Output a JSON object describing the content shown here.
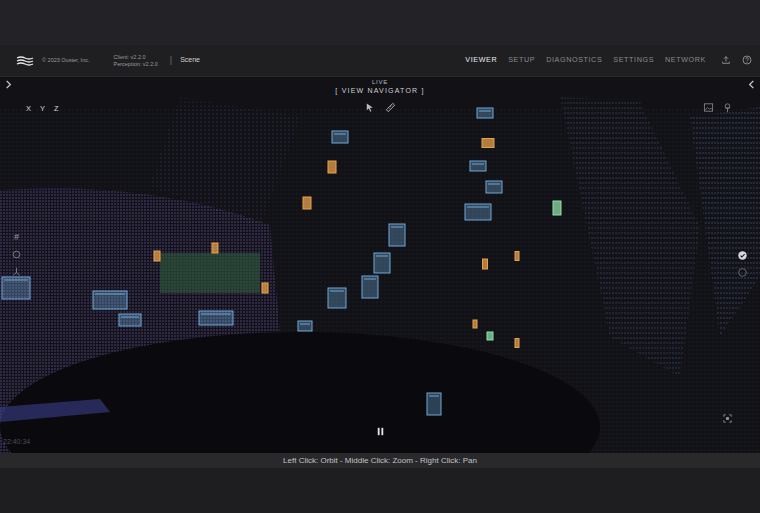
{
  "app": {
    "copyright": "© 2023 Ouster, Inc.",
    "client": "Client: v2.2.0",
    "perception": "Perception: v2.2.0",
    "separator": "|",
    "scene": "Scene"
  },
  "nav": [
    {
      "label": "VIEWER",
      "selected": true
    },
    {
      "label": "SETUP",
      "selected": false
    },
    {
      "label": "DIAGNOSTICS",
      "selected": false
    },
    {
      "label": "SETTINGS",
      "selected": false
    },
    {
      "label": "NETWORK",
      "selected": false
    }
  ],
  "viewer": {
    "live": "LIVE",
    "navigator": "[ VIEW NAVIGATOR ]",
    "axes": [
      "X",
      "Y",
      "Z"
    ],
    "grid_glyph": "#",
    "toggles": [
      {
        "checked": true
      },
      {
        "checked": false
      }
    ],
    "timestamp": "22:40:34",
    "objects": [
      {
        "kind": "vehicle",
        "color": "#6fa8d6"
      },
      {
        "kind": "vehicle",
        "color": "#6fa8d6"
      },
      {
        "kind": "pedestrian",
        "color": "#e8a24a"
      },
      {
        "kind": "vehicle",
        "color": "#6fa8d6"
      },
      {
        "kind": "vehicle",
        "color": "#6fa8d6"
      },
      {
        "kind": "vehicle",
        "color": "#6fa8d6"
      },
      {
        "kind": "vehicle",
        "color": "#6fa8d6"
      },
      {
        "kind": "vehicle",
        "color": "#6fa8d6"
      },
      {
        "kind": "vehicle",
        "color": "#6fa8d6"
      },
      {
        "kind": "vehicle",
        "color": "#6fa8d6"
      },
      {
        "kind": "vehicle",
        "color": "#6fa8d6"
      },
      {
        "kind": "vehicle",
        "color": "#6fa8d6"
      },
      {
        "kind": "vehicle",
        "color": "#6fa8d6"
      },
      {
        "kind": "vehicle",
        "color": "#6fa8d6"
      },
      {
        "kind": "vehicle",
        "color": "#6fa8d6"
      },
      {
        "kind": "vehicle",
        "color": "#6fa8d6"
      },
      {
        "kind": "pedestrian",
        "color": "#e8a24a"
      },
      {
        "kind": "pedestrian",
        "color": "#e8a24a"
      },
      {
        "kind": "pedestrian",
        "color": "#e8a24a"
      },
      {
        "kind": "pedestrian",
        "color": "#e8a24a"
      },
      {
        "kind": "pedestrian",
        "color": "#e8a24a"
      },
      {
        "kind": "pedestrian",
        "color": "#e8a24a"
      },
      {
        "kind": "pedestrian",
        "color": "#e8a24a"
      },
      {
        "kind": "pedestrian",
        "color": "#e8a24a"
      },
      {
        "kind": "bicycle",
        "color": "#8fe0a8"
      },
      {
        "kind": "bicycle",
        "color": "#8fe0a8"
      },
      {
        "kind": "pedestrian",
        "color": "#e8a24a"
      }
    ]
  },
  "status_bar": "Left Click: Orbit - Middle Click: Zoom - Right Click: Pan"
}
